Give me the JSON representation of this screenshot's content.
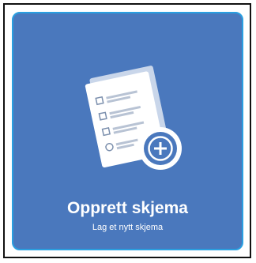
{
  "card": {
    "title": "Opprett skjema",
    "subtitle": "Lag et nytt skjema",
    "icon": "form-add-icon",
    "colors": {
      "background": "#4a78bd",
      "border": "#2a9fe0",
      "text": "#ffffff"
    }
  }
}
